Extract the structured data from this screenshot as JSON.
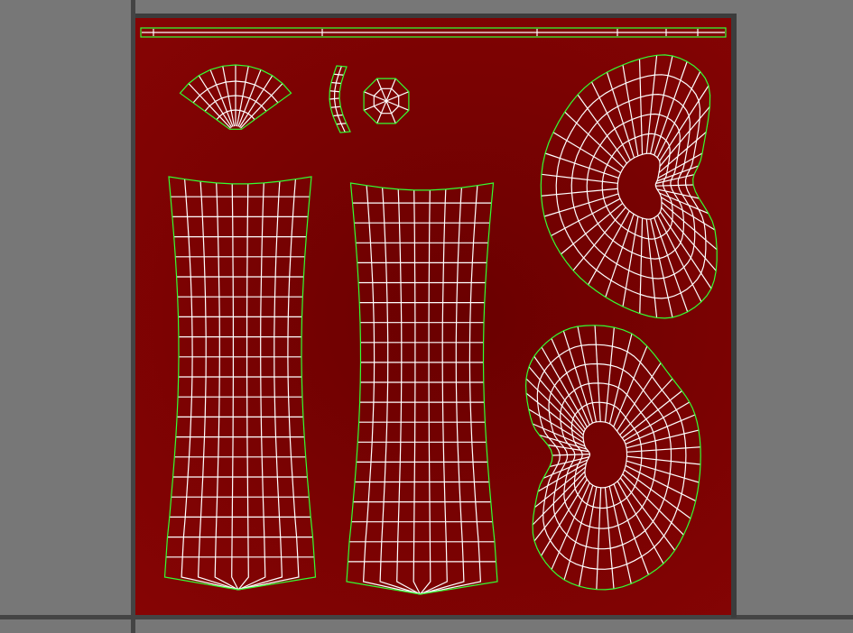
{
  "viewport": {
    "background": "#777777",
    "grid_line_color": "#444444"
  },
  "uv_editor": {
    "texture_color": "#7a0202",
    "seam_color": "#33ff33",
    "edge_color": "#ffffff",
    "islands": [
      {
        "name": "top-strip"
      },
      {
        "name": "fan-cap"
      },
      {
        "name": "curved-strip"
      },
      {
        "name": "octagon-cap"
      },
      {
        "name": "left-tube"
      },
      {
        "name": "right-tube"
      },
      {
        "name": "upper-bean"
      },
      {
        "name": "lower-bean"
      }
    ]
  }
}
